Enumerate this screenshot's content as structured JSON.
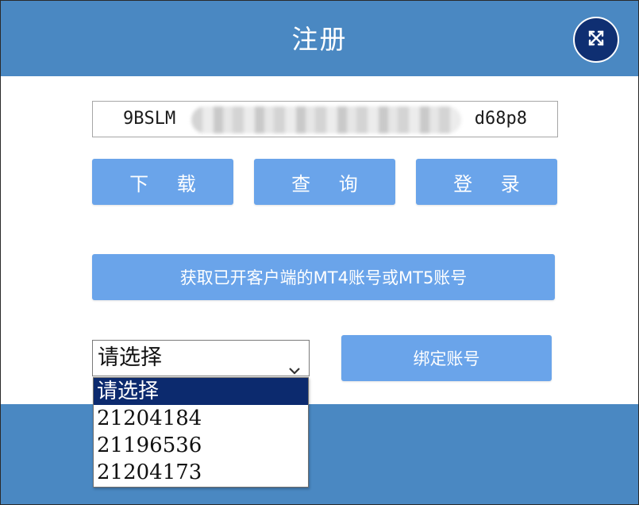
{
  "dialog": {
    "title": "注册",
    "close_icon": "close-icon"
  },
  "key_field": {
    "visible_start": "9BSLM",
    "visible_end": "d68p8",
    "middle_obscured": true
  },
  "buttons": {
    "download": "下 载",
    "query": "查 询",
    "login": "登 录",
    "fetch_accounts": "获取已开客户端的MT4账号或MT5账号",
    "bind_account": "绑定账号"
  },
  "account_select": {
    "selected": "请选择",
    "chevron_icon": "chevron-down-icon",
    "options": [
      "请选择",
      "21204184",
      "21196536",
      "21204173"
    ],
    "highlighted_index": 0
  },
  "colors": {
    "header": "#4a88c2",
    "button": "#6aa4ea",
    "close_button": "#0f2f72",
    "selected_option": "#0c2a6e"
  }
}
